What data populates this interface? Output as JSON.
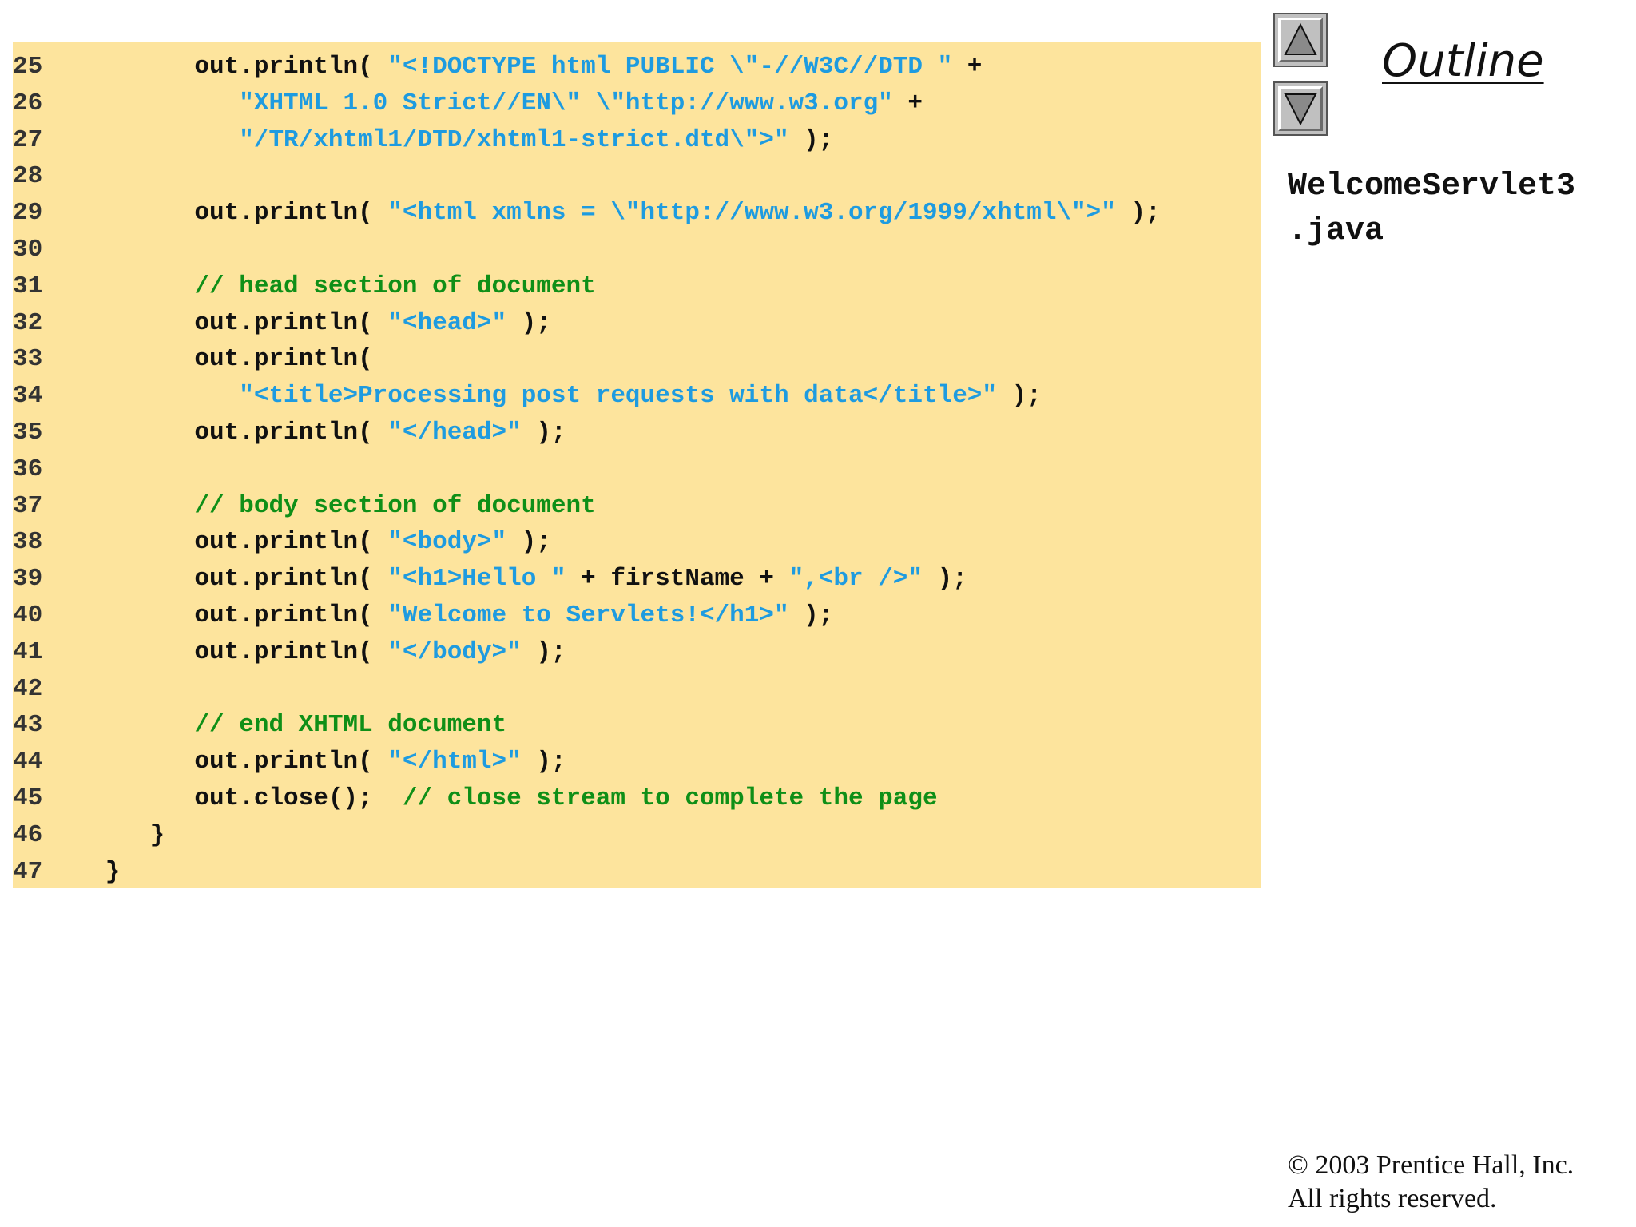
{
  "colors": {
    "code_background": "#fde49d",
    "string_color": "#1e9be0",
    "comment_color": "#0f8f17",
    "code_color": "#111111"
  },
  "sidebar": {
    "up_icon": "triangle-up-icon",
    "down_icon": "triangle-down-icon",
    "outline_label": "Outline",
    "file_name_line1": "WelcomeServlet3",
    "file_name_line2": ".java"
  },
  "footer": {
    "copyright_line1": "© 2003 Prentice Hall, Inc.",
    "copyright_line2": "All rights reserved."
  },
  "code_lines": [
    {
      "num": "25",
      "tokens": [
        {
          "t": "         out.println( ",
          "k": "plain"
        },
        {
          "t": "\"<!DOCTYPE html PUBLIC \\\"-//W3C//DTD \"",
          "k": "str"
        },
        {
          "t": " +",
          "k": "plain"
        }
      ]
    },
    {
      "num": "26",
      "tokens": [
        {
          "t": "            ",
          "k": "plain"
        },
        {
          "t": "\"XHTML 1.0 Strict//EN\\\" \\\"http://www.w3.org\"",
          "k": "str"
        },
        {
          "t": " +",
          "k": "plain"
        }
      ]
    },
    {
      "num": "27",
      "tokens": [
        {
          "t": "            ",
          "k": "plain"
        },
        {
          "t": "\"/TR/xhtml1/DTD/xhtml1-strict.dtd\\\">\"",
          "k": "str"
        },
        {
          "t": " );",
          "k": "plain"
        }
      ]
    },
    {
      "num": "28",
      "tokens": []
    },
    {
      "num": "29",
      "tokens": [
        {
          "t": "         out.println( ",
          "k": "plain"
        },
        {
          "t": "\"<html xmlns = \\\"http://www.w3.org/1999/xhtml\\\">\"",
          "k": "str"
        },
        {
          "t": " );",
          "k": "plain"
        }
      ]
    },
    {
      "num": "30",
      "tokens": []
    },
    {
      "num": "31",
      "tokens": [
        {
          "t": "         ",
          "k": "plain"
        },
        {
          "t": "// head section of document",
          "k": "comment"
        }
      ]
    },
    {
      "num": "32",
      "tokens": [
        {
          "t": "         out.println( ",
          "k": "plain"
        },
        {
          "t": "\"<head>\"",
          "k": "str"
        },
        {
          "t": " );",
          "k": "plain"
        }
      ]
    },
    {
      "num": "33",
      "tokens": [
        {
          "t": "         out.println(",
          "k": "plain"
        }
      ]
    },
    {
      "num": "34",
      "tokens": [
        {
          "t": "            ",
          "k": "plain"
        },
        {
          "t": "\"<title>Processing post requests with data</title>\"",
          "k": "str"
        },
        {
          "t": " );",
          "k": "plain"
        }
      ]
    },
    {
      "num": "35",
      "tokens": [
        {
          "t": "         out.println( ",
          "k": "plain"
        },
        {
          "t": "\"</head>\"",
          "k": "str"
        },
        {
          "t": " );",
          "k": "plain"
        }
      ]
    },
    {
      "num": "36",
      "tokens": []
    },
    {
      "num": "37",
      "tokens": [
        {
          "t": "         ",
          "k": "plain"
        },
        {
          "t": "// body section of document",
          "k": "comment"
        }
      ]
    },
    {
      "num": "38",
      "tokens": [
        {
          "t": "         out.println( ",
          "k": "plain"
        },
        {
          "t": "\"<body>\"",
          "k": "str"
        },
        {
          "t": " );",
          "k": "plain"
        }
      ]
    },
    {
      "num": "39",
      "tokens": [
        {
          "t": "         out.println( ",
          "k": "plain"
        },
        {
          "t": "\"<h1>Hello \"",
          "k": "str"
        },
        {
          "t": " + firstName + ",
          "k": "plain"
        },
        {
          "t": "\",<br />\"",
          "k": "str"
        },
        {
          "t": " );",
          "k": "plain"
        }
      ]
    },
    {
      "num": "40",
      "tokens": [
        {
          "t": "         out.println( ",
          "k": "plain"
        },
        {
          "t": "\"Welcome to Servlets!</h1>\"",
          "k": "str"
        },
        {
          "t": " );",
          "k": "plain"
        }
      ]
    },
    {
      "num": "41",
      "tokens": [
        {
          "t": "         out.println( ",
          "k": "plain"
        },
        {
          "t": "\"</body>\"",
          "k": "str"
        },
        {
          "t": " );",
          "k": "plain"
        }
      ]
    },
    {
      "num": "42",
      "tokens": []
    },
    {
      "num": "43",
      "tokens": [
        {
          "t": "         ",
          "k": "plain"
        },
        {
          "t": "// end XHTML document",
          "k": "comment"
        }
      ]
    },
    {
      "num": "44",
      "tokens": [
        {
          "t": "         out.println( ",
          "k": "plain"
        },
        {
          "t": "\"</html>\"",
          "k": "str"
        },
        {
          "t": " );",
          "k": "plain"
        }
      ]
    },
    {
      "num": "45",
      "tokens": [
        {
          "t": "         out.close();  ",
          "k": "plain"
        },
        {
          "t": "// close stream to complete the page",
          "k": "comment"
        }
      ]
    },
    {
      "num": "46",
      "tokens": [
        {
          "t": "      }",
          "k": "plain"
        }
      ]
    },
    {
      "num": "47",
      "tokens": [
        {
          "t": "   }",
          "k": "plain"
        }
      ]
    }
  ]
}
